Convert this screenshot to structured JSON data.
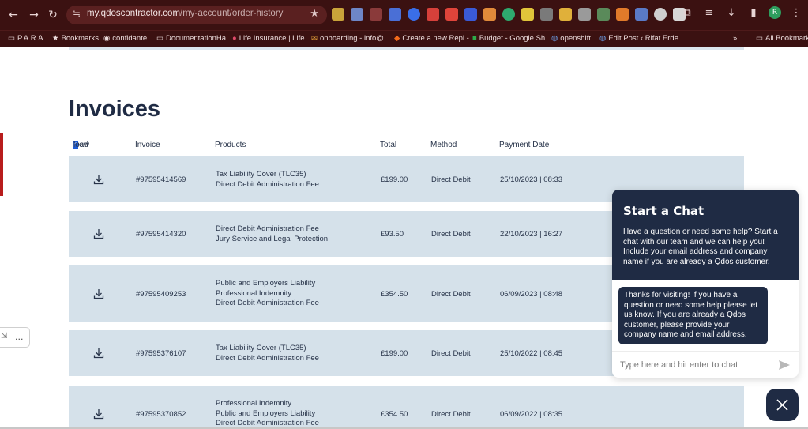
{
  "browser": {
    "url_host": "my.qdoscontractor.com",
    "url_path": "/my-account/order-history",
    "bookmarks": [
      {
        "label": "P.A.R.A",
        "icon": "folder-icon"
      },
      {
        "label": "Bookmarks",
        "icon": "star-icon"
      },
      {
        "label": "confidante",
        "icon": "globe-icon"
      },
      {
        "label": "DocumentationHa...",
        "icon": "folder-icon"
      },
      {
        "label": "Life Insurance | Life...",
        "icon": "site-icon"
      },
      {
        "label": "onboarding - info@...",
        "icon": "mail-icon"
      },
      {
        "label": "Create a new Repl -...",
        "icon": "replit-icon"
      },
      {
        "label": "Budget - Google Sh...",
        "icon": "sheets-icon"
      },
      {
        "label": "openshift",
        "icon": "wordpress-icon"
      },
      {
        "label": "Edit Post ‹ Rifat Erde...",
        "icon": "wordpress-icon"
      },
      {
        "label": "»",
        "icon": ""
      },
      {
        "label": "All Bookmarks",
        "icon": "folder-icon"
      }
    ],
    "avatar_letter": "R"
  },
  "page": {
    "title": "Invoices",
    "columns": {
      "download_a": "Dow",
      "download_b": "n",
      "download_c": "load",
      "invoice": "Invoice",
      "products": "Products",
      "total": "Total",
      "method": "Method",
      "payment_date": "Payment Date"
    },
    "rows": [
      {
        "invoice": "#97595414569",
        "products": [
          "Tax Liability Cover (TLC35)",
          "Direct Debit Administration Fee"
        ],
        "total": "£199.00",
        "method": "Direct Debit",
        "date": "25/10/2023 | 08:33"
      },
      {
        "invoice": "#97595414320",
        "products": [
          "Direct Debit Administration Fee",
          "Jury Service and Legal Protection"
        ],
        "total": "£93.50",
        "method": "Direct Debit",
        "date": "22/10/2023 | 16:27"
      },
      {
        "invoice": "#97595409253",
        "products": [
          "Public and Employers Liability",
          "Professional Indemnity",
          "Direct Debit Administration Fee"
        ],
        "total": "£354.50",
        "method": "Direct Debit",
        "date": "06/09/2023 | 08:48"
      },
      {
        "invoice": "#97595376107",
        "products": [
          "Tax Liability Cover (TLC35)",
          "Direct Debit Administration Fee"
        ],
        "total": "£199.00",
        "method": "Direct Debit",
        "date": "25/10/2022 | 08:45"
      },
      {
        "invoice": "#97595370852",
        "products": [
          "Professional Indemnity",
          "Public and Employers Liability",
          "Direct Debit Administration Fee"
        ],
        "total": "£354.50",
        "method": "Direct Debit",
        "date": "06/09/2022 | 08:35"
      }
    ],
    "side_ghost_label": "..."
  },
  "chat": {
    "title": "Start a Chat",
    "description": "Have a question or need some help? Start a chat with our team and we can help you! Include your email address and company name if you are already a Qdos customer.",
    "message": "Thanks for visiting! If you have a question or need some help please let us know. If you are already a Qdos customer, please provide your company name and email address.",
    "input_placeholder": "Type here and hit enter to chat"
  },
  "colors": {
    "browser_chrome": "#3b1111",
    "row_background": "#d5e1ea",
    "brand_navy": "#1f2b44",
    "selection_blue": "#1d5cd6"
  }
}
